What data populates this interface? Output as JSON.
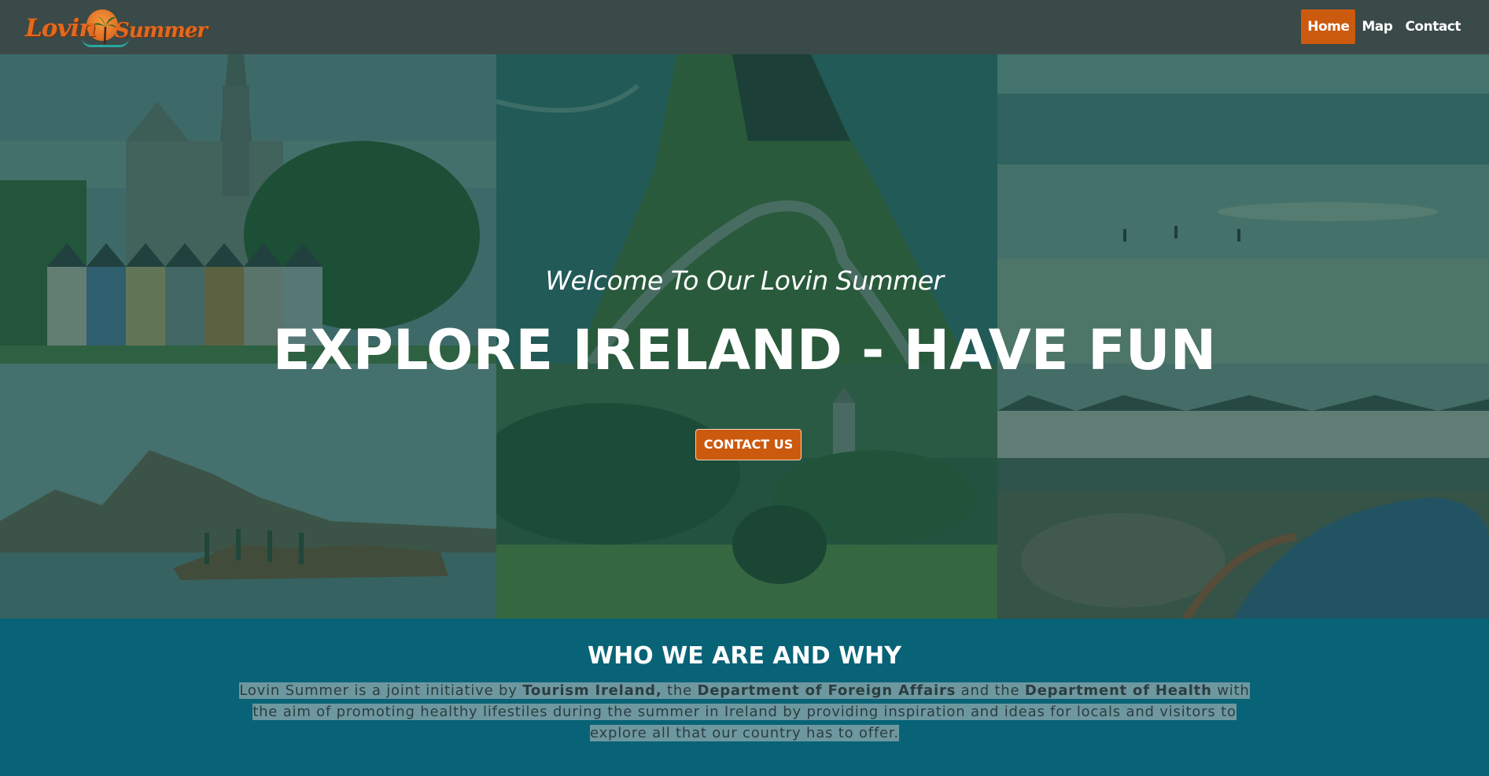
{
  "brand": {
    "logo_left": "Lovin",
    "logo_right": "Summer",
    "accent_color": "#cb5a0e",
    "navbar_color": "#3a4a48",
    "section_color": "#086377"
  },
  "nav": {
    "items": [
      {
        "label": "Home",
        "active": true
      },
      {
        "label": "Map",
        "active": false
      },
      {
        "label": "Contact",
        "active": false
      }
    ]
  },
  "hero": {
    "welcome": "Welcome To Our Lovin Summer",
    "headline": "EXPLORE IRELAND - HAVE FUN",
    "cta_label": "CONTACT US"
  },
  "about": {
    "title": "WHO WE ARE AND WHY",
    "p1": "Lovin Summer is a joint initiative by ",
    "b1": "Tourism Ireland,",
    "p2": " the ",
    "b2": "Department of Foreign Affairs",
    "p3": " and the ",
    "b3": "Department of Health",
    "p4": " with the aim of promoting healthy lifestiles during the summer in Ireland by providing inspiration and ideas for locals and visitors to explore all that our country has to offer."
  }
}
